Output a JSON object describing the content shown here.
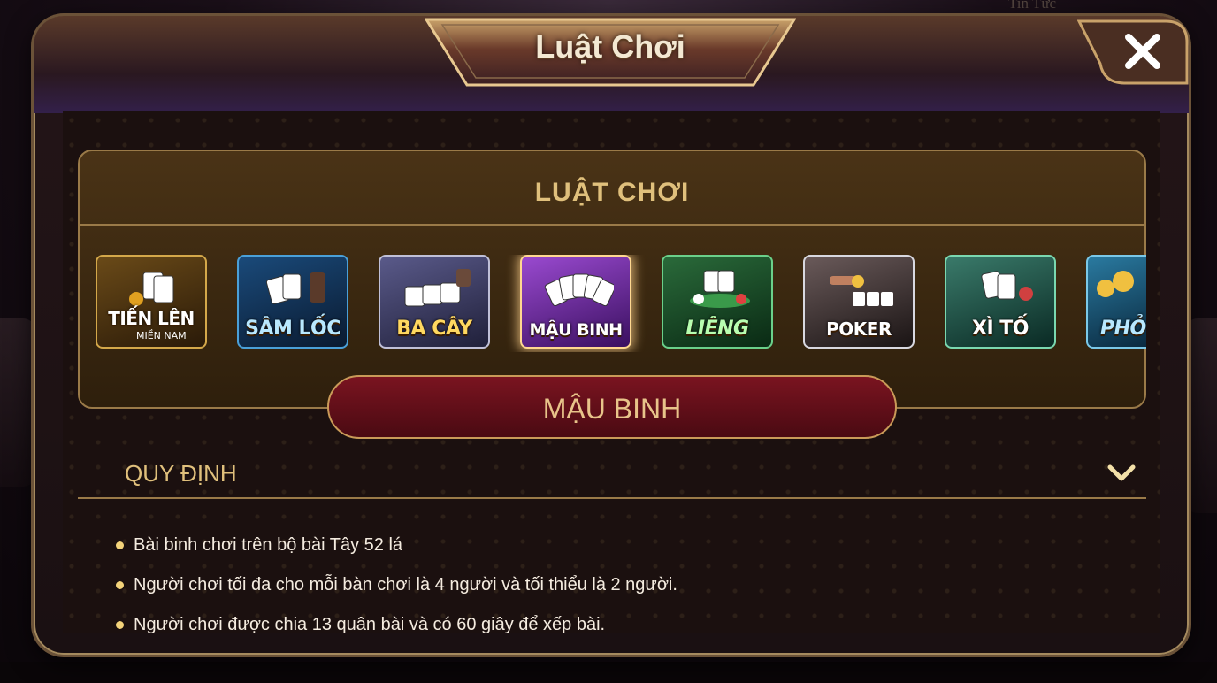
{
  "background": {
    "top_label": "Tin Tức"
  },
  "dialog": {
    "title": "Luật Chơi",
    "close_icon": "close-icon"
  },
  "rules_panel": {
    "heading": "LUẬT CHƠI",
    "games": [
      {
        "label": "TIẾN LÊN",
        "sublabel": "MIỀN NAM",
        "theme": "#a07a28"
      },
      {
        "label": "SÂM LỐC",
        "sublabel": "",
        "theme": "#2a6aa0"
      },
      {
        "label": "BA CÂY",
        "sublabel": "",
        "theme": "#5a5a8a"
      },
      {
        "label": "MẬU BINH",
        "sublabel": "",
        "theme": "#8a3ac0"
      },
      {
        "label": "LIÊNG",
        "sublabel": "",
        "theme": "#2a8a4a"
      },
      {
        "label": "POKER",
        "sublabel": "",
        "theme": "#6a5a5a"
      },
      {
        "label": "XÌ TỐ",
        "sublabel": "",
        "theme": "#3a8a6a"
      },
      {
        "label": "PHỎ",
        "sublabel": "",
        "theme": "#2a7aa0"
      }
    ],
    "selected_game": "MẬU BINH"
  },
  "section": {
    "title": "QUY ĐỊNH",
    "chevron_icon": "chevron-down-icon",
    "rules": [
      "Bài binh chơi trên bộ bài Tây 52 lá",
      "Người chơi tối đa cho mỗi bàn chơi là 4 người và tối thiểu là 2 người.",
      "Người chơi được chia 13 quân bài và có 60 giây để xếp bài."
    ]
  },
  "colors": {
    "gold_text": "#e0c07c",
    "banner_red": "#7a1420",
    "frame": "#9a7a48"
  }
}
